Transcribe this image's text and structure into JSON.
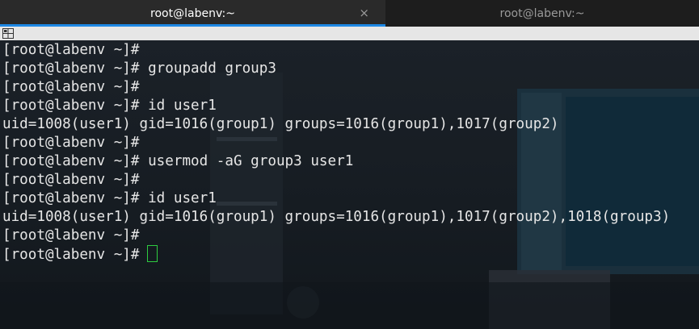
{
  "tabs": [
    {
      "title": "root@labenv:~",
      "active": true
    },
    {
      "title": "root@labenv:~",
      "active": false
    }
  ],
  "tab_close_symbol": "×",
  "terminal": {
    "lines": [
      "[root@labenv ~]#",
      "[root@labenv ~]# groupadd group3",
      "[root@labenv ~]#",
      "[root@labenv ~]# id user1",
      "uid=1008(user1) gid=1016(group1) groups=1016(group1),1017(group2)",
      "[root@labenv ~]#",
      "[root@labenv ~]# usermod -aG group3 user1",
      "[root@labenv ~]#",
      "[root@labenv ~]# id user1",
      "uid=1008(user1) gid=1016(group1) groups=1016(group1),1017(group2),1018(group3)",
      "[root@labenv ~]#",
      "[root@labenv ~]#"
    ],
    "cursor_color": "#2ecc40",
    "text_color": "#e6e6e6"
  },
  "colors": {
    "tab_active_bg": "#2a2a2a",
    "tab_indicator": "#1e88e5",
    "tabbar_bg": "#1d1d1d"
  },
  "icons": {
    "split": "split-view-icon",
    "close": "close-icon"
  }
}
